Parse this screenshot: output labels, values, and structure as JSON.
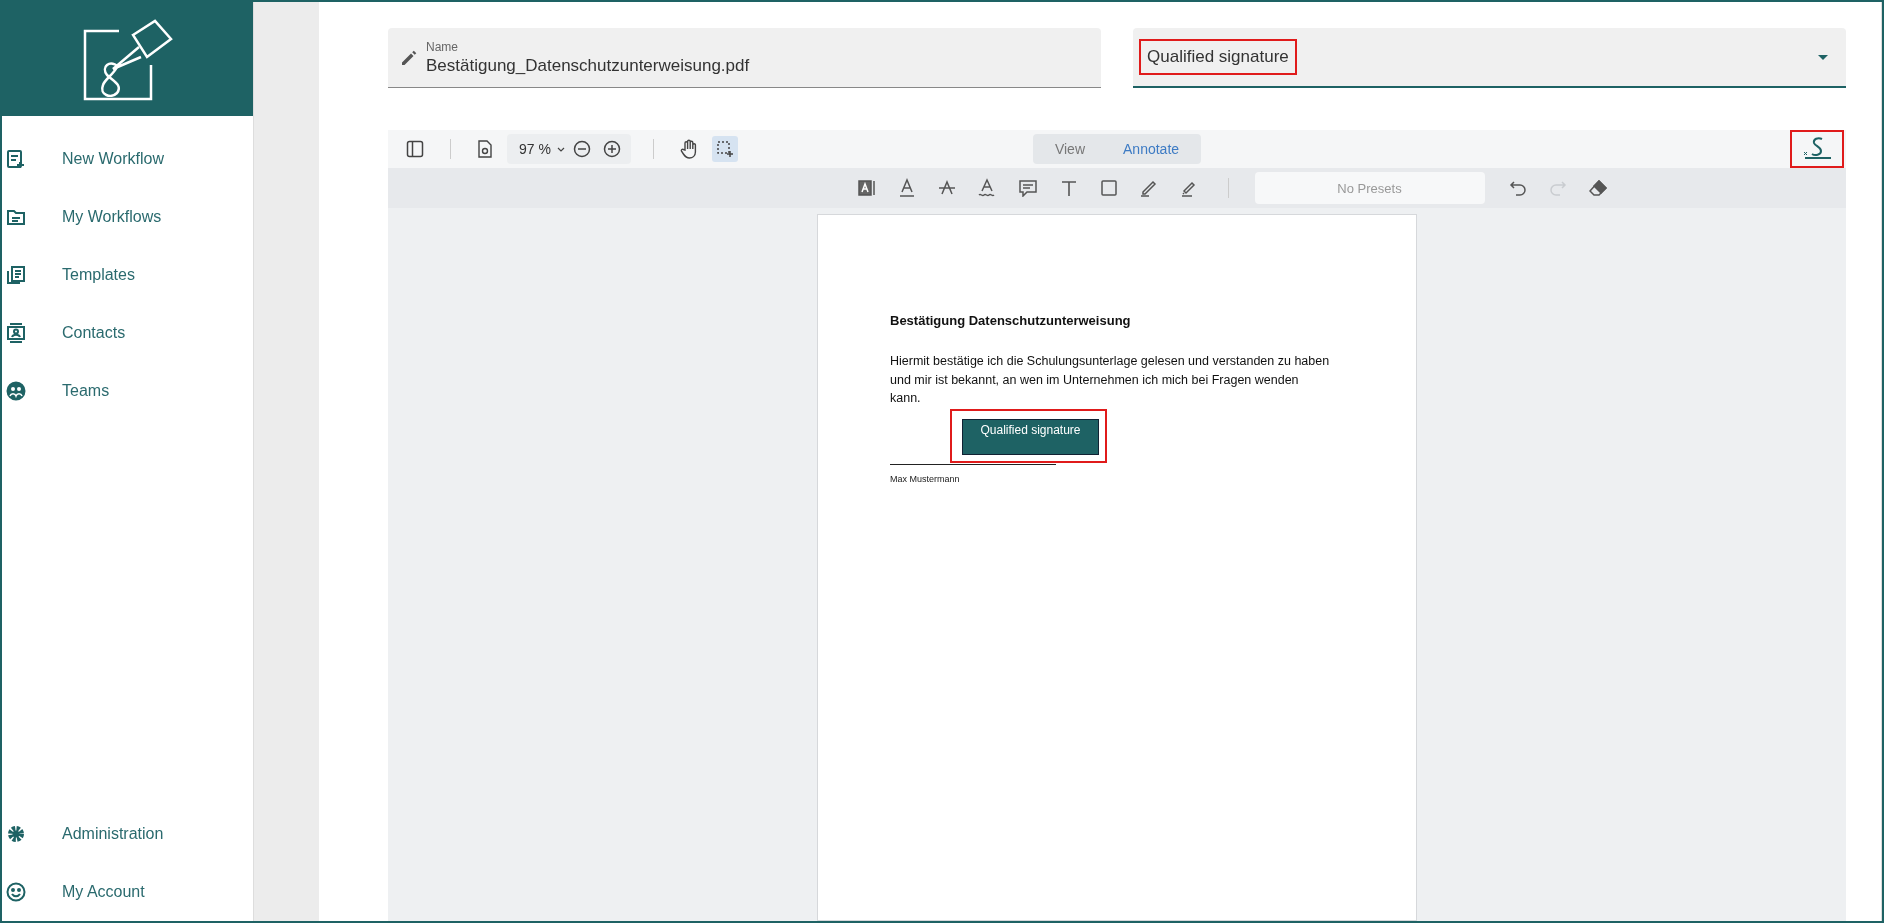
{
  "sidebar": {
    "items": [
      {
        "label": "New Workflow"
      },
      {
        "label": "My Workflows"
      },
      {
        "label": "Templates"
      },
      {
        "label": "Contacts"
      },
      {
        "label": "Teams"
      }
    ],
    "bottom_items": [
      {
        "label": "Administration"
      },
      {
        "label": "My Account"
      }
    ]
  },
  "name_field": {
    "label": "Name",
    "value": "Bestätigung_Datenschutzunterweisung.pdf"
  },
  "signature_type": {
    "value": "Qualified signature",
    "highlighted": true
  },
  "viewer": {
    "zoom": "97 %",
    "select_tool_active": true,
    "modes": [
      {
        "label": "View",
        "selected": false
      },
      {
        "label": "Annotate",
        "selected": true
      }
    ],
    "presets": {
      "placeholder": "No Presets"
    },
    "redo_disabled": true,
    "signature_button": {
      "highlighted": true
    }
  },
  "document": {
    "title": "Bestätigung Datenschutzunterweisung",
    "paragraph": "Hiermit bestätige ich die Schulungsunterlage gelesen und verstanden zu haben und mir ist bekannt, an wen im Unternehmen ich mich bei Fragen wenden kann.",
    "signature_field": {
      "label": "Qualified signature",
      "highlighted": true
    },
    "signer": "Max Mustermann"
  }
}
